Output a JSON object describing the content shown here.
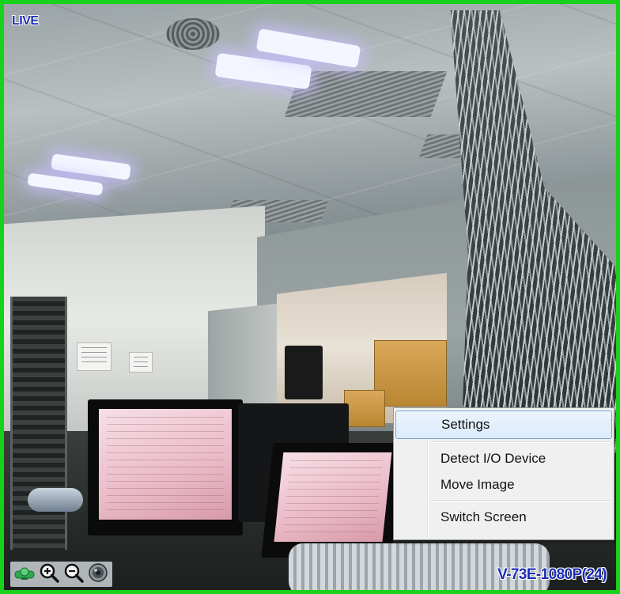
{
  "overlay": {
    "live_label": "LIVE",
    "camera_label": "V-73E-1080P(24)"
  },
  "toolbar": {
    "items": [
      {
        "name": "camera-link-icon",
        "icon": "green-camera"
      },
      {
        "name": "zoom-in-icon",
        "icon": "magnifier-plus"
      },
      {
        "name": "zoom-out-icon",
        "icon": "magnifier-minus"
      },
      {
        "name": "speaker-icon",
        "icon": "round-speaker"
      }
    ]
  },
  "context_menu": {
    "items": [
      {
        "label": "Settings",
        "highlighted": true
      },
      {
        "label": "Detect I/O Device",
        "highlighted": false
      },
      {
        "label": "Move Image",
        "highlighted": false
      },
      {
        "label": "Switch Screen",
        "highlighted": false
      }
    ]
  },
  "colors": {
    "frame_border": "#18d11a",
    "overlay_text": "#1b2db8",
    "menu_background": "#f0f0f0",
    "menu_highlight_border": "#7da2ce"
  }
}
